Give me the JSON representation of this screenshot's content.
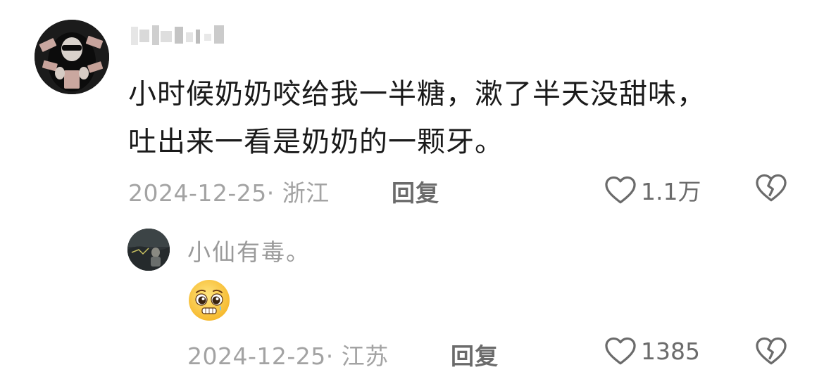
{
  "comment": {
    "text_line1": "小时候奶奶咬给我一半糖，漱了半天没甜味，",
    "text_line2": "吐出来一看是奶奶的一颗牙。",
    "date_location": "2024-12-25· 浙江",
    "reply_label": "回复",
    "like_count": "1.1万",
    "icons": [
      "heart-outline-icon",
      "broken-heart-icon"
    ]
  },
  "reply": {
    "username": "小仙有毒。",
    "emoji": "pleading-face-emoji",
    "date_location": "2024-12-25· 江苏",
    "reply_label": "回复",
    "like_count": "1385",
    "icons": [
      "heart-outline-icon",
      "broken-heart-icon"
    ]
  },
  "colors": {
    "primary_text": "#1a1a1a",
    "meta_text": "#a3a3a3",
    "action_text": "#6b6b6b",
    "username_text": "#9a9a9a"
  }
}
